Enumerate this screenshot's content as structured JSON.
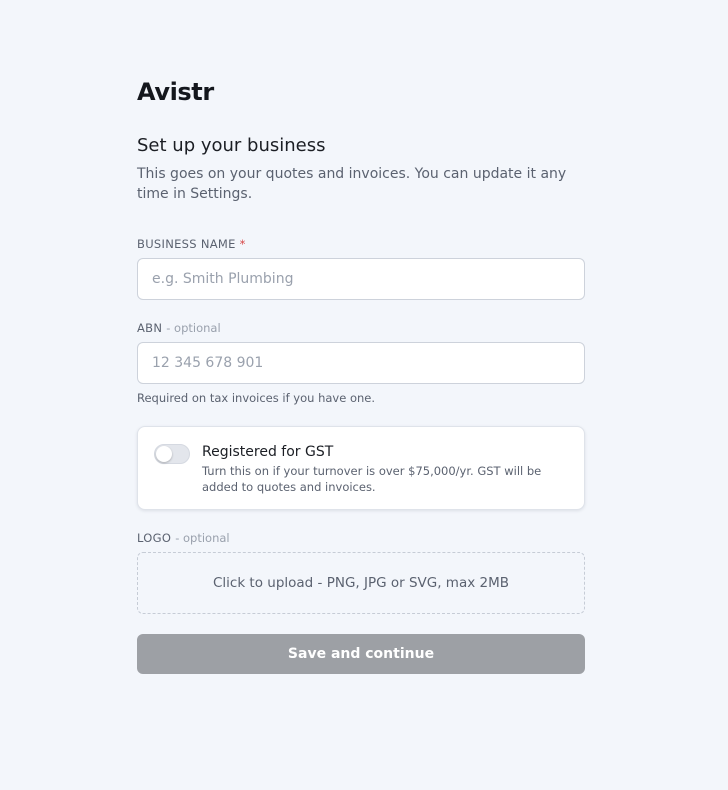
{
  "brand": "Avistr",
  "heading": "Set up your business",
  "subtitle": "This goes on your quotes and invoices. You can update it any time in Settings.",
  "form": {
    "business_name": {
      "label": "BUSINESS NAME",
      "required_marker": "*",
      "value": "",
      "placeholder": "e.g. Smith Plumbing"
    },
    "abn": {
      "label": "ABN",
      "optional_text": "- optional",
      "value": "",
      "placeholder": "12 345 678 901",
      "help": "Required on tax invoices if you have one."
    },
    "gst": {
      "title": "Registered for GST",
      "description": "Turn this on if your turnover is over $75,000/yr. GST will be added to quotes and invoices.",
      "enabled": false
    },
    "logo": {
      "label": "LOGO",
      "optional_text": "- optional",
      "upload_text": "Click to upload - PNG, JPG or SVG, max 2MB"
    }
  },
  "save_button": "Save and continue",
  "colors": {
    "background": "#f3f6fb",
    "required": "#d64545",
    "button_disabled": "#9da0a5",
    "text_muted": "#5b6270"
  }
}
